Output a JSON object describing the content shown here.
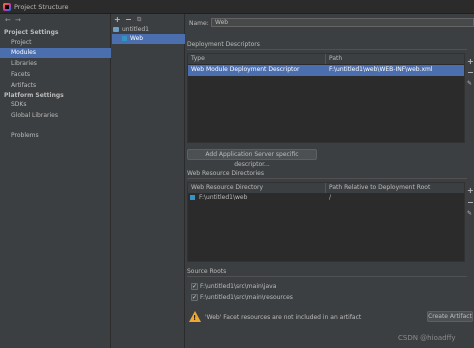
{
  "window": {
    "title": "Project Structure"
  },
  "nav": {
    "project_settings_header": "Project Settings",
    "project_settings": [
      "Project",
      "Modules",
      "Libraries",
      "Facets",
      "Artifacts"
    ],
    "platform_settings_header": "Platform Settings",
    "platform_settings": [
      "SDKs",
      "Global Libraries"
    ],
    "problems": "Problems",
    "selected": "Modules",
    "back_glyph": "←",
    "forward_glyph": "→"
  },
  "tree": {
    "add_glyph": "+",
    "remove_glyph": "−",
    "copy_glyph": "⧉",
    "root": "untitled1",
    "child": "Web"
  },
  "facet": {
    "name_label": "Name:",
    "name_value": "Web"
  },
  "deployment_descriptors": {
    "title": "Deployment Descriptors",
    "columns": [
      "Type",
      "Path"
    ],
    "rows": [
      {
        "type": "Web Module Deployment Descriptor",
        "path": "F:\\untitled1\\web\\WEB-INF\\web.xml"
      }
    ],
    "add_server_button": "Add Application Server specific descriptor..."
  },
  "web_resource_directories": {
    "title": "Web Resource Directories",
    "columns": [
      "Web Resource Directory",
      "Path Relative to Deployment Root"
    ],
    "rows": [
      {
        "dir": "F:\\untitled1\\web",
        "relative": "/"
      }
    ]
  },
  "source_roots": {
    "title": "Source Roots",
    "items": [
      {
        "path": "F:\\untitled1\\src\\main\\java",
        "checked": true
      },
      {
        "path": "F:\\untitled1\\src\\main\\resources",
        "checked": true
      }
    ]
  },
  "warning": {
    "text": "'Web' Facet resources are not included in an artifact",
    "create_button": "Create Artifact"
  },
  "side_tools": {
    "add": "+",
    "remove": "−",
    "edit": "✎"
  },
  "watermark": "CSDN @hioadffy",
  "colors": {
    "selection": "#4b6eaf",
    "background": "#3c3f41",
    "table": "#2b2b2b",
    "warning": "#f0a732"
  }
}
